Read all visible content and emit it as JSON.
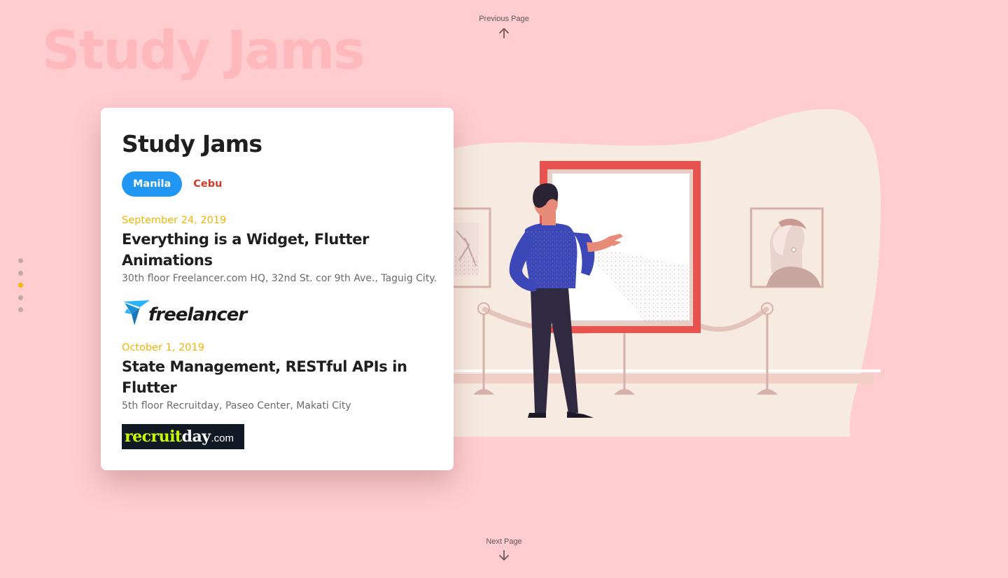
{
  "page": {
    "watermark_title": "Study Jams",
    "previous_label": "Previous Page",
    "next_label": "Next Page",
    "section_dots": {
      "count": 5,
      "active_index": 2
    }
  },
  "card": {
    "title": "Study Jams",
    "tabs": [
      {
        "label": "Manila",
        "active": true
      },
      {
        "label": "Cebu",
        "active": false
      }
    ],
    "events": [
      {
        "date": "September 24, 2019",
        "title": "Everything is a Widget, Flutter Animations",
        "venue": "30th floor Freelancer.com HQ, 32nd St. cor 9th Ave., Taguig City.",
        "sponsor": {
          "name": "freelancer",
          "logo_icon": "freelancer-bird-icon"
        }
      },
      {
        "date": "October 1, 2019",
        "title": "State Management, RESTful APIs in Flutter",
        "venue": "5th floor Recruitday, Paseo Center, Makati City",
        "sponsor": {
          "name_main": "recruit",
          "name_accent": "day",
          "name_tld": ".com"
        }
      }
    ]
  },
  "colors": {
    "background": "#ffcdd0",
    "accent_yellow": "#f5b400",
    "tab_active_blue": "#2196f3",
    "tab_inactive_red": "#d23a2c",
    "frame_red": "#e8524f"
  },
  "icons": {
    "previous": "arrow-up-icon",
    "next": "arrow-down-icon"
  }
}
